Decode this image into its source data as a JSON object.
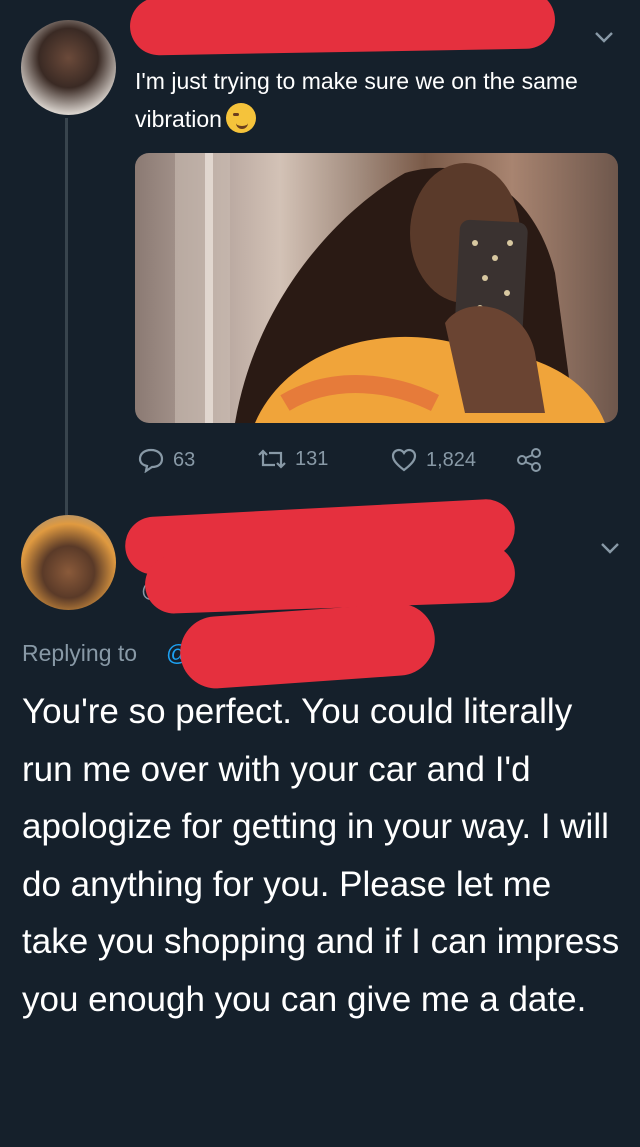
{
  "tweet1": {
    "text": "I'm just trying to make sure we on the same vibration",
    "emoji": "smirking-face",
    "stats": {
      "replies": "63",
      "retweets": "131",
      "likes": "1,824"
    }
  },
  "tweet2": {
    "handle_partial": "@",
    "replying_label": "Replying to",
    "mention_partial": "@",
    "text": "You're so perfect. You could literally run me over with your car and I'd apologize for getting in your way. I will do anything for you. Please let me take you shopping and if I can impress you enough you can give me a date."
  },
  "colors": {
    "background": "#15202b",
    "muted": "#8899a6",
    "link": "#1da1f2",
    "redaction": "#e5303e"
  }
}
